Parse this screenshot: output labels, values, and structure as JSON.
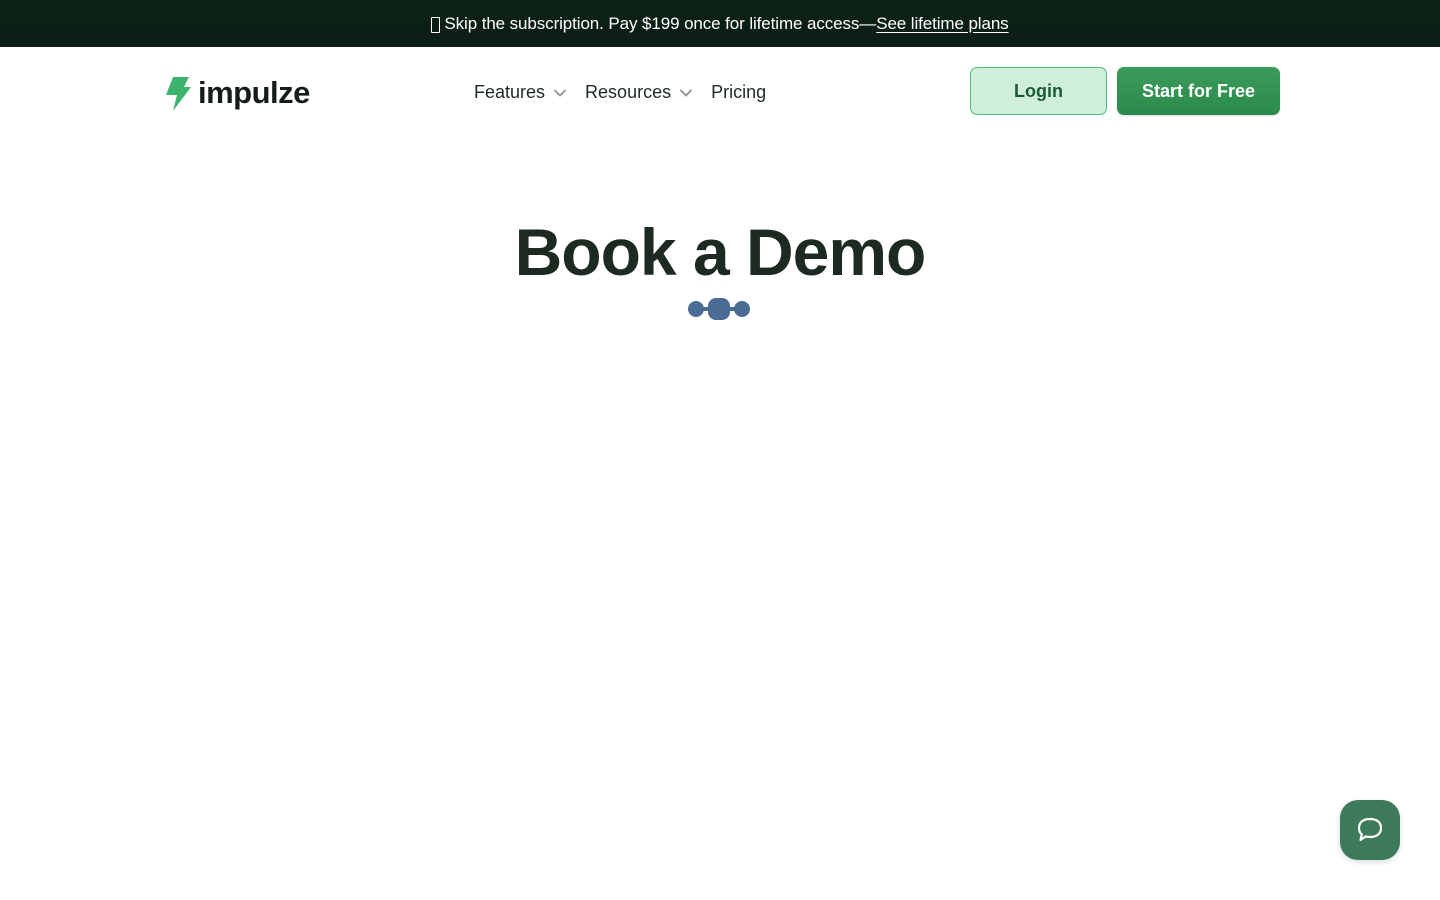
{
  "promo": {
    "text": "Skip the subscription. Pay $199 once for lifetime access— ",
    "link": "See lifetime plans"
  },
  "brand": {
    "name": "impulze",
    "icon": "lightning-bolt-icon",
    "color": "#3cb46e"
  },
  "nav": {
    "features": "Features",
    "resources": "Resources",
    "pricing": "Pricing"
  },
  "actions": {
    "login": "Login",
    "start": "Start for Free"
  },
  "main": {
    "title": "Book a Demo",
    "loader_icon": "loading-dots-icon"
  },
  "chat": {
    "icon": "chat-bubble-icon"
  },
  "colors": {
    "promo_bg": "#0e2218",
    "accent": "#2e8f4f",
    "login_bg": "#cfeedb",
    "loader": "#4a6b93",
    "chat_bg": "#3d7a59"
  }
}
